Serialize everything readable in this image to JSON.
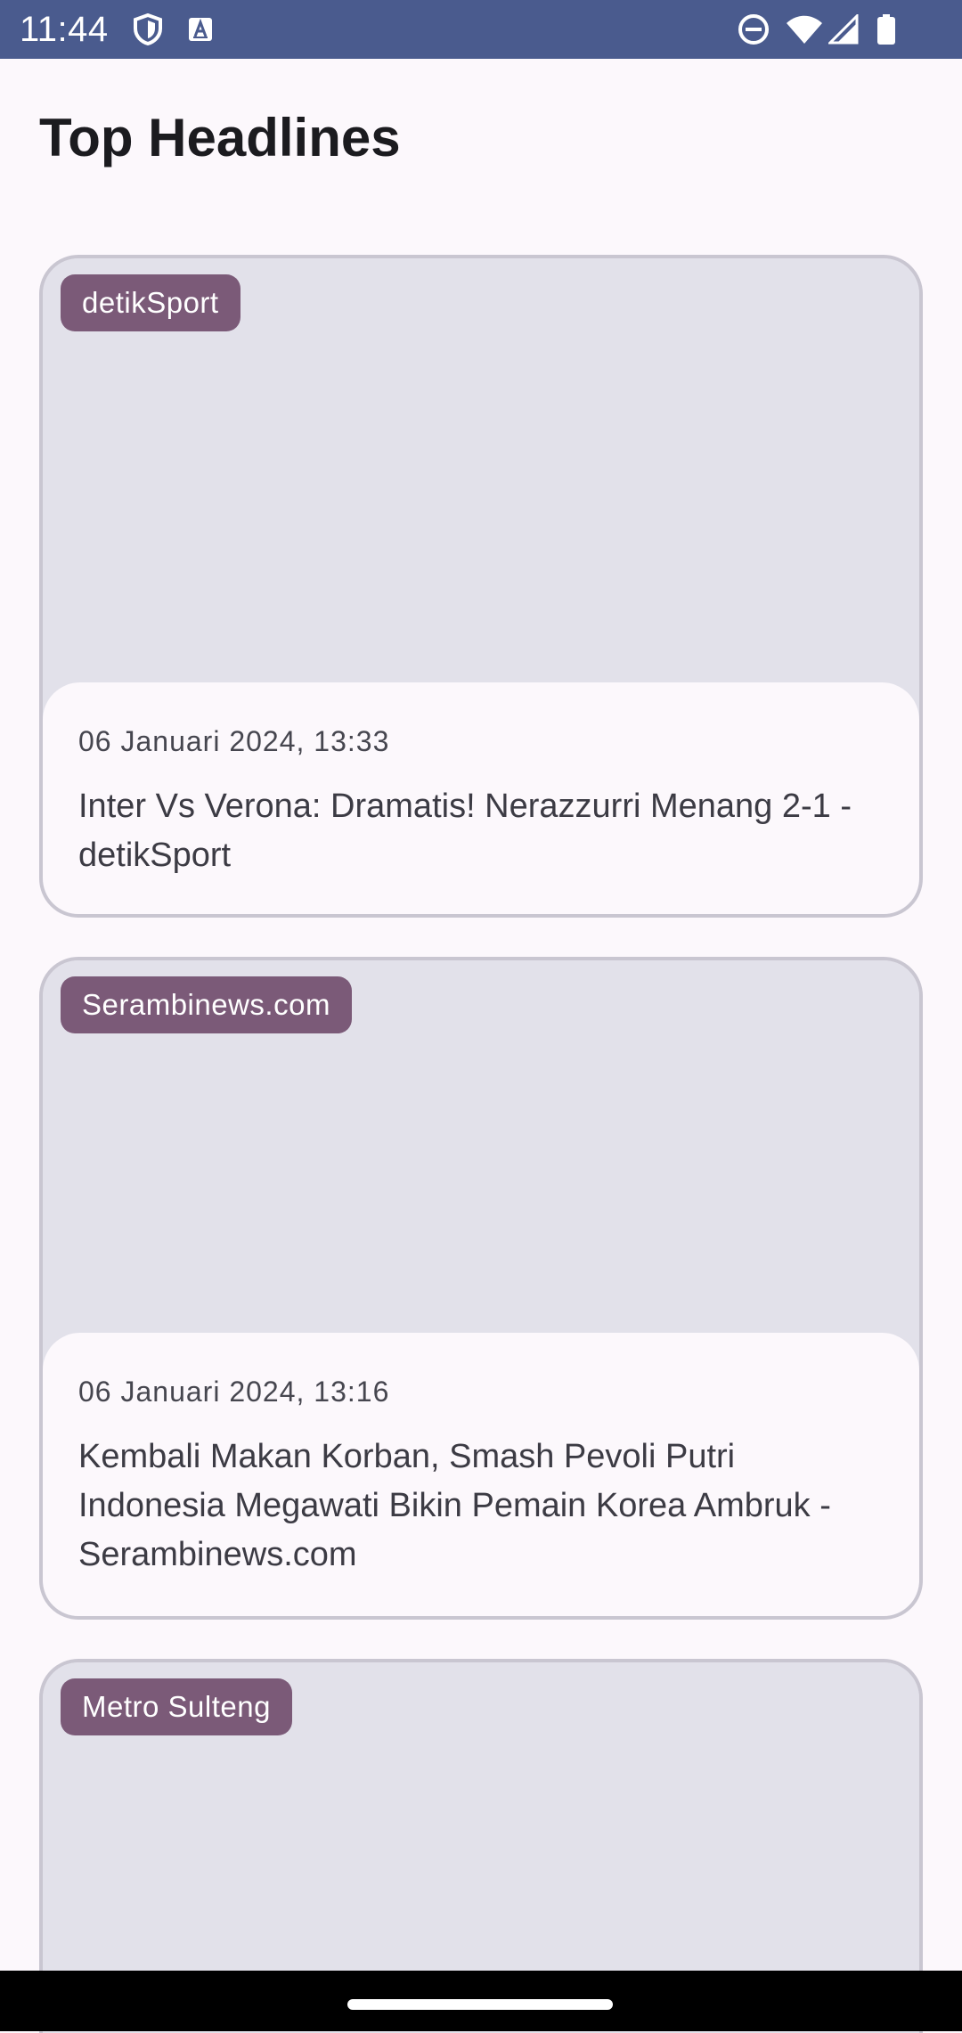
{
  "status_bar": {
    "time": "11:44",
    "left_icons": [
      "shield-icon",
      "keyboard-a-icon"
    ],
    "right_icons": [
      "do-not-disturb-icon",
      "wifi-icon",
      "cellular-signal-icon",
      "battery-icon"
    ],
    "background_color": "#4a5b8e"
  },
  "header": {
    "title": "Top Headlines"
  },
  "articles": [
    {
      "source": "detikSport",
      "date": "06 Januari 2024, 13:33",
      "title": "Inter Vs Verona: Dramatis! Nerazzurri Menang 2-1 - detikSport"
    },
    {
      "source": "Serambinews.com",
      "date": "06 Januari 2024, 13:16",
      "title": "Kembali Makan Korban, Smash Pevoli Putri Indonesia Megawati Bikin Pemain Korea Ambruk - Serambinews.com"
    },
    {
      "source": "Metro Sulteng"
    }
  ],
  "colors": {
    "badge": "#7b5a78",
    "card_placeholder": "#e2e1ea",
    "background": "#fcf8fc"
  }
}
